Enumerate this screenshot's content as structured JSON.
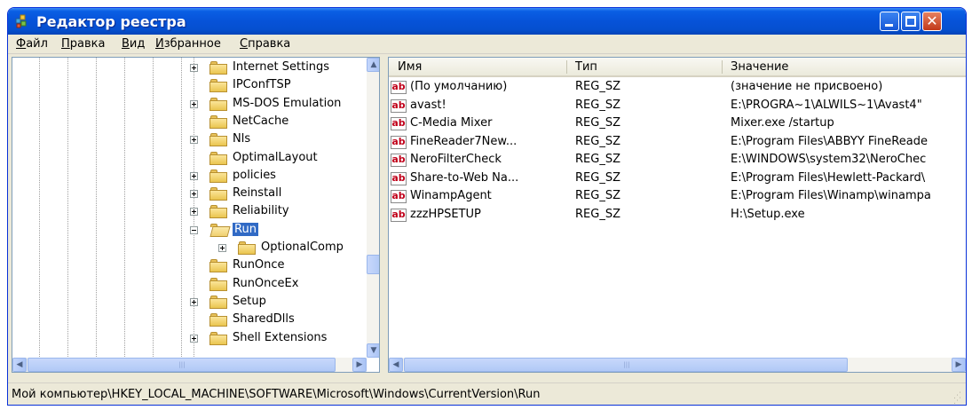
{
  "window": {
    "title": "Редактор реестра",
    "icon": "regedit-icon",
    "controls": {
      "minimize": "minimize-icon",
      "maximize": "maximize-icon",
      "close": "close-icon"
    }
  },
  "menu": [
    "Файл",
    "Правка",
    "Вид",
    "Избранное",
    "Справка"
  ],
  "tree": {
    "items": [
      {
        "label": "Internet Settings",
        "expandable": true,
        "selected": false
      },
      {
        "label": "IPConfTSP",
        "expandable": false,
        "selected": false
      },
      {
        "label": "MS-DOS Emulation",
        "expandable": true,
        "selected": false
      },
      {
        "label": "NetCache",
        "expandable": false,
        "selected": false
      },
      {
        "label": "Nls",
        "expandable": true,
        "selected": false
      },
      {
        "label": "OptimalLayout",
        "expandable": false,
        "selected": false
      },
      {
        "label": "policies",
        "expandable": true,
        "selected": false
      },
      {
        "label": "Reinstall",
        "expandable": true,
        "selected": false
      },
      {
        "label": "Reliability",
        "expandable": true,
        "selected": false
      },
      {
        "label": "Run",
        "expandable": true,
        "expanded": true,
        "selected": true
      },
      {
        "label": "OptionalComp",
        "expandable": true,
        "selected": false,
        "child": true
      },
      {
        "label": "RunOnce",
        "expandable": false,
        "selected": false
      },
      {
        "label": "RunOnceEx",
        "expandable": false,
        "selected": false
      },
      {
        "label": "Setup",
        "expandable": true,
        "selected": false
      },
      {
        "label": "SharedDlls",
        "expandable": false,
        "selected": false
      },
      {
        "label": "Shell Extensions",
        "expandable": true,
        "selected": false
      }
    ]
  },
  "list": {
    "columns": [
      "Имя",
      "Тип",
      "Значение"
    ],
    "rows": [
      {
        "name": "(По умолчанию)",
        "type": "REG_SZ",
        "value": "(значение не присвоено)"
      },
      {
        "name": "avast!",
        "type": "REG_SZ",
        "value": "E:\\PROGRA~1\\ALWILS~1\\Avast4\""
      },
      {
        "name": "C-Media Mixer",
        "type": "REG_SZ",
        "value": "Mixer.exe /startup"
      },
      {
        "name": "FineReader7New...",
        "type": "REG_SZ",
        "value": "E:\\Program Files\\ABBYY FineReade"
      },
      {
        "name": "NeroFilterCheck",
        "type": "REG_SZ",
        "value": "E:\\WINDOWS\\system32\\NeroChec"
      },
      {
        "name": "Share-to-Web Na...",
        "type": "REG_SZ",
        "value": "E:\\Program Files\\Hewlett-Packard\\"
      },
      {
        "name": "WinampAgent",
        "type": "REG_SZ",
        "value": "E:\\Program Files\\Winamp\\winampa"
      },
      {
        "name": "zzzHPSETUP",
        "type": "REG_SZ",
        "value": "H:\\Setup.exe"
      }
    ],
    "row_icon": "string-value-icon",
    "row_icon_text": "ab"
  },
  "status": "Мой компьютер\\HKEY_LOCAL_MACHINE\\SOFTWARE\\Microsoft\\Windows\\CurrentVersion\\Run",
  "colors": {
    "titlebar": "#0652d8",
    "selection": "#316ac5",
    "chrome": "#ece9d8"
  }
}
